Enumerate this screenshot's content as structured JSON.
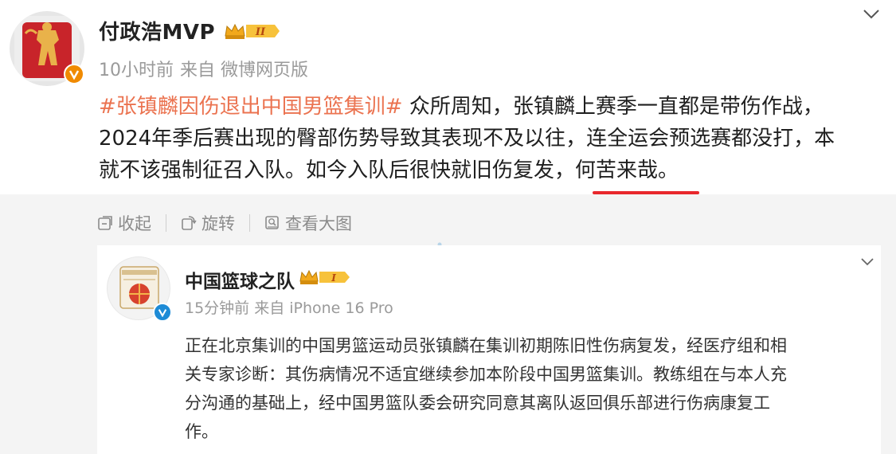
{
  "post": {
    "username": "付政浩MVP",
    "time": "10小时前",
    "source": "来自 微博网页版",
    "hashtag": "#张镇麟因伤退出中国男篮集训#",
    "body_line1": " 众所周知，张镇麟上赛季一直都是带伤作战，",
    "body_line2": "2024年季后赛出现的臀部伤势导致其表现不及以往，连全运会预选赛都没打，本",
    "body_line3": "就不该强制征召入队。如今入队后很快就旧伤复发，",
    "body_highlight": "何苦来哉。",
    "vip_level": "II"
  },
  "toolbar": {
    "collapse_label": "收起",
    "rotate_label": "旋转",
    "view_large_label": "查看大图"
  },
  "quoted": {
    "username": "中国篮球之队",
    "time": "15分钟前",
    "source": "来自 iPhone 16 Pro",
    "vip_level": "I",
    "text_line1": "正在北京集训的中国男篮运动员张镇麟在集训初期陈旧性伤病复发，经医疗组和相",
    "text_line2": "关专家诊断：其伤病情况不适宜继续参加本阶段中国男篮集训。教练组在与本人充",
    "text_line3": "分沟通的基础上，经中国男篮队委会研究同意其离队返回俱乐部进行伤病康复工",
    "text_line4": "作。"
  },
  "colors": {
    "hashtag": "#eb7350",
    "underline": "#e8272c",
    "verify_orange": "#f08a00",
    "verify_blue": "#1e8bd6",
    "meta_gray": "#9a9a9a"
  }
}
